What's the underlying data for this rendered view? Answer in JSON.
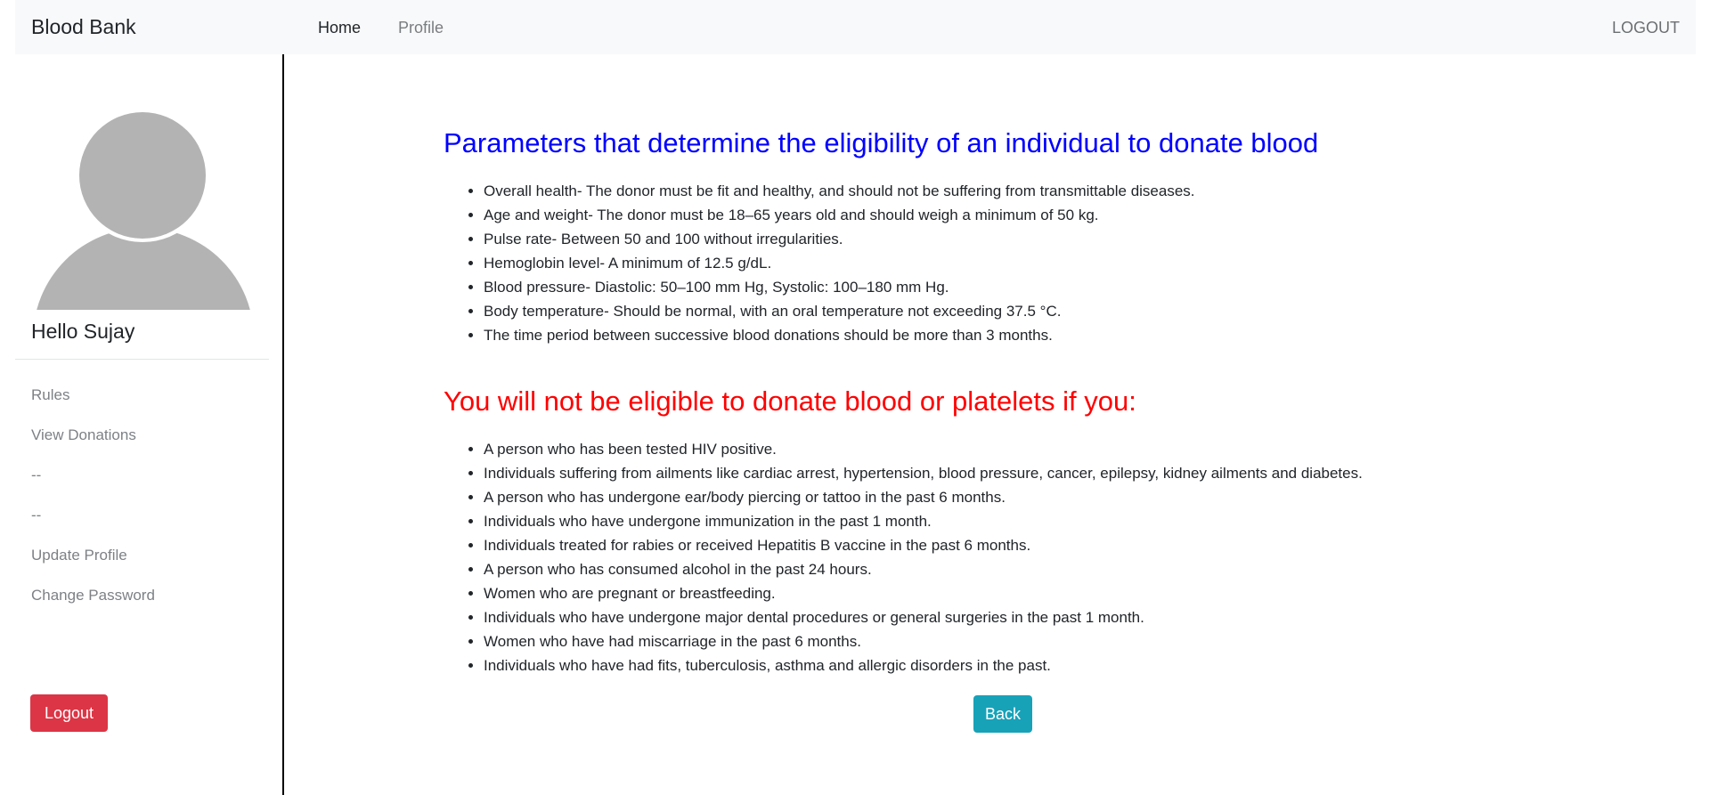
{
  "navbar": {
    "brand": "Blood Bank",
    "links": [
      "Home",
      "Profile"
    ],
    "logout": "LOGOUT"
  },
  "sidebar": {
    "greeting": "Hello Sujay",
    "items": [
      "Rules",
      "View Donations",
      "--",
      "--",
      "Update Profile",
      "Change Password"
    ],
    "logout_button": "Logout"
  },
  "main": {
    "eligibility_heading": "Parameters that determine the eligibility of an individual to donate blood",
    "eligibility_items": [
      "Overall health- The donor must be fit and healthy, and should not be suffering from transmittable diseases.",
      "Age and weight- The donor must be 18–65 years old and should weigh a minimum of 50 kg.",
      "Pulse rate- Between 50 and 100 without irregularities.",
      "Hemoglobin level- A minimum of 12.5 g/dL.",
      "Blood pressure- Diastolic: 50–100 mm Hg, Systolic: 100–180 mm Hg.",
      "Body temperature- Should be normal, with an oral temperature not exceeding 37.5 °C.",
      "The time period between successive blood donations should be more than 3 months."
    ],
    "ineligible_heading": "You will not be eligible to donate blood or platelets if you:",
    "ineligible_items": [
      "A person who has been tested HIV positive.",
      "Individuals suffering from ailments like cardiac arrest, hypertension, blood pressure, cancer, epilepsy, kidney ailments and diabetes.",
      "A person who has undergone ear/body piercing or tattoo in the past 6 months.",
      "Individuals who have undergone immunization in the past 1 month.",
      "Individuals treated for rabies or received Hepatitis B vaccine in the past 6 months.",
      "A person who has consumed alcohol in the past 24 hours.",
      "Women who are pregnant or breastfeeding.",
      "Individuals who have undergone major dental procedures or general surgeries in the past 1 month.",
      "Women who have had miscarriage in the past 6 months.",
      "Individuals who have had fits, tuberculosis, asthma and allergic disorders in the past."
    ],
    "back_button": "Back"
  },
  "colors": {
    "heading_blue": "#0000ff",
    "heading_red": "#ff0000",
    "logout_button": "#dc3545",
    "back_button": "#17a2b8",
    "avatar": "#b3b3b3"
  },
  "icons": {
    "avatar": "user-avatar-icon"
  }
}
